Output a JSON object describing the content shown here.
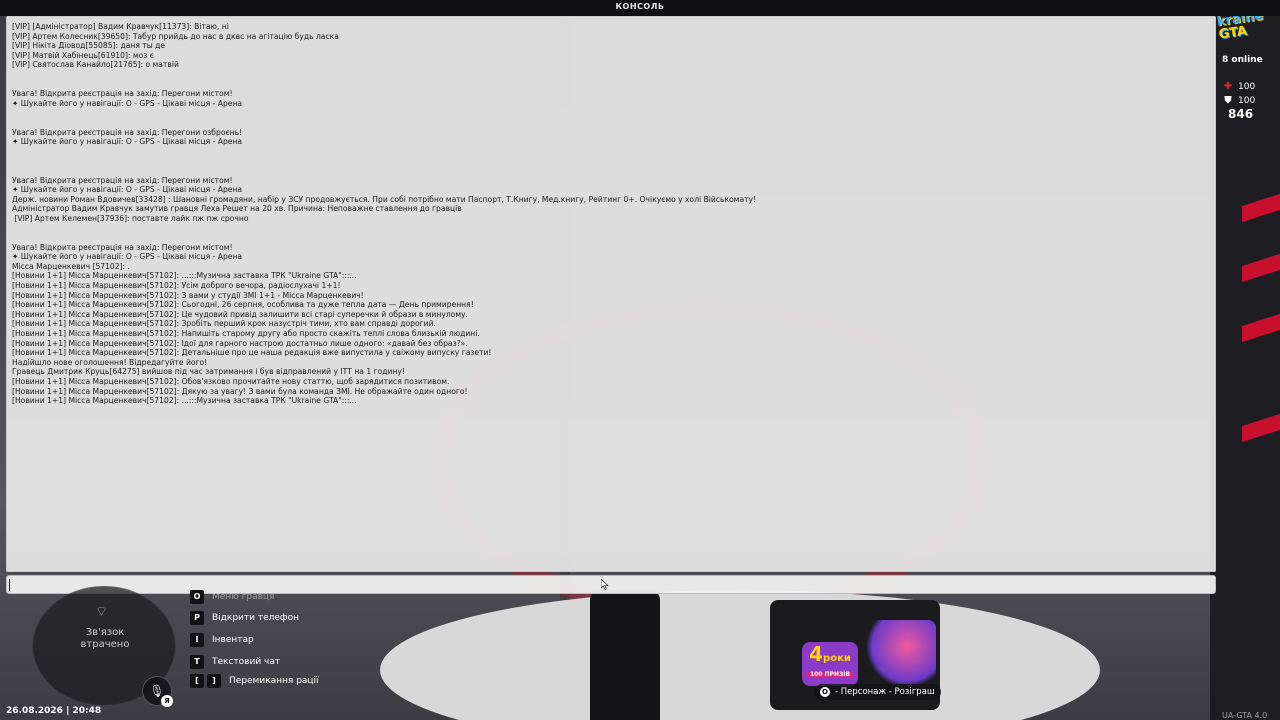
{
  "console": {
    "title": "КОНСОЛЬ",
    "input_value": "",
    "lines": [
      "[VIP] [Адміністратор] Вадим Кравчук[11373]: Вітаю, ні",
      "[VIP] Артем Колесник[39650]: Табур прийдь до нас в дквс на агітацію будь ласка",
      "[VIP] Нікіта Діовод[55085]: даня ты де",
      "[VIP] Матвій Хабінець[61910]: моз є",
      "[VIP] Святослав Канайло[21765]: о матвій",
      "",
      "",
      "Увага! Відкрита реєстрація на захід: Перегони містом!",
      "✦ Шукайте його у навігації: O - GPS - Цікаві місця - Арена",
      "",
      "",
      "Увага! Відкрита реєстрація на захід: Перегони озброєнь!",
      "✦ Шукайте його у навігації: O - GPS - Цікаві місця - Арена",
      "",
      "",
      "",
      "Увага! Відкрита реєстрація на захід: Перегони містом!",
      "✦ Шукайте його у навігації: O - GPS - Цікаві місця - Арена",
      "Держ. новини Роман Вдовичев[33428] : Шановні громадяни, набір у ЗСУ продовжується. При собі потрібно мати Паспорт, Т.Книгу, Мед.книгу, Рейтинг 0+. Очікуємо у холі Військомату!",
      "Адміністратор Вадим Кравчук замутив гравця Леха Решет на 20 хв. Причина: Неповажне ставлення до гравців",
      " [VIP] Артем Келемен[37936]: поставте лайк пж пж срочно",
      "",
      "",
      "Увага! Відкрита реєстрація на захід: Перегони містом!",
      "✦ Шукайте його у навігації: O - GPS - Цікаві місця - Арена",
      "Місса Марценкевич [57102]: .",
      "[Новини 1+1] Місса Марценкевич[57102]: ...:::Музична заставка ТРК \"Ukraine GTA\":::...",
      "[Новини 1+1] Місса Марценкевич[57102]: Усім доброго вечора, радіослухачі 1+1!",
      "[Новини 1+1] Місса Марценкевич[57102]: З вами у студії ЗМІ 1+1 - Місса Марценкевич!",
      "[Новини 1+1] Місса Марценкевич[57102]: Сьогодні, 26 серпня, особлива та дуже тепла дата — День примирення!",
      "[Новини 1+1] Місса Марценкевич[57102]: Це чудовий привід залишити всі старі суперечки й образи в минулому.",
      "[Новини 1+1] Місса Марценкевич[57102]: Зробіть перший крок назустріч тими, хто вам справді дорогий.",
      "[Новини 1+1] Місса Марценкевич[57102]: Напишіть старому другу або просто скажіть теплі слова близькій людині.",
      "[Новини 1+1] Місса Марценкевич[57102]: Ідої для гарного настрою достатньо лише одного: «давай без образ?».",
      "[Новини 1+1] Місса Марценкевич[57102]: Детальніше про це наша редакція вже випустила у свіжому випуску газети!",
      "Надійшло нове оголошення! Відредагуйте його!",
      "Гравець Дмитрик Круць[64275] вийшов під час затримання і був відправлений у ІТТ на 1 годину!",
      "[Новини 1+1] Місса Марценкевич[57102]: Обов'язково прочитайте нову статтю, щоб зарядитися позитивом.",
      "[Новини 1+1] Місса Марценкевич[57102]: Дякую за увагу! З вами була команда ЗМІ. Не ображайте один одного!",
      "[Новини 1+1] Місса Марценкевич[57102]: ...:::Музична заставка ТРК \"Ukraine GTA\":::..."
    ]
  },
  "hud": {
    "logo_top": "kraine",
    "logo_bottom": "GTA",
    "online": "8 online",
    "health": "100",
    "armor": "100",
    "money": "846"
  },
  "minimap": {
    "status": "Зв'язок\nвтрачено",
    "mic_badge": "Я"
  },
  "datetime": "26.08.2026 | 20:48",
  "hints": [
    {
      "key": "O",
      "label": "Меню гравця"
    },
    {
      "key": "P",
      "label": "Відкрити телефон"
    },
    {
      "key": "I",
      "label": "Інвентар"
    },
    {
      "key": "T",
      "label": "Текстовий чат"
    },
    {
      "keys": [
        "[",
        "]"
      ],
      "label": "Перемикання рації"
    }
  ],
  "promo": {
    "badge_number": "4",
    "badge_word": "роки",
    "badge_sub": "100 ПРИЗІВ",
    "label_key": "O",
    "label": "- Персонаж - Розіграш"
  },
  "version": "UA-GTA 4.0",
  "colors": {
    "accent_red": "#c8102e",
    "console_bg": "#e8e8e8",
    "health": "#e8243a"
  }
}
